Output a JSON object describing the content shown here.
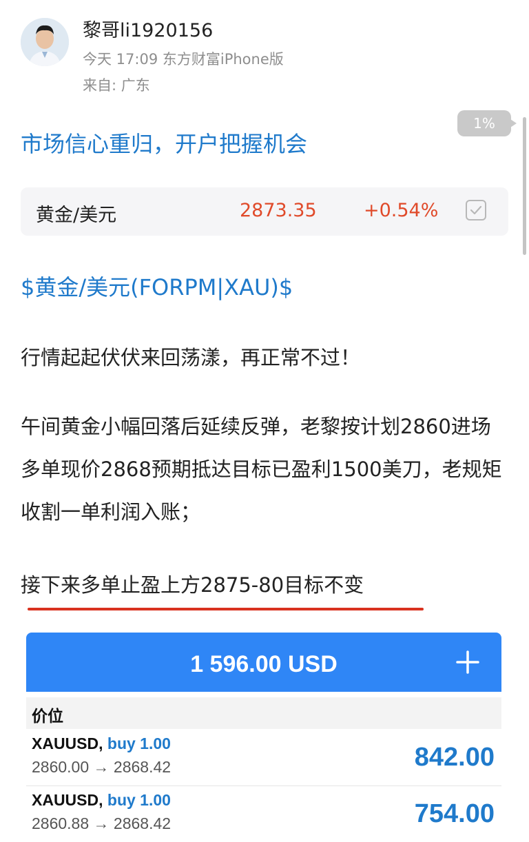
{
  "post": {
    "username": "黎哥li1920156",
    "time_source": "今天 17:09 东方财富iPhone版",
    "from": "来自: 广东",
    "progress": "1%",
    "title": "市场信心重归，开户把握机会"
  },
  "quote": {
    "name": "黄金/美元",
    "price": "2873.35",
    "change": "+0.54%"
  },
  "body": {
    "tag_link": "$黄金/美元(FORPM|XAU)$",
    "p1": "行情起起伏伏来回荡漾，再正常不过！",
    "p2": "午间黄金小幅回落后延续反弹，老黎按计划2860进场多单现价2868预期抵达目标已盈利1500美刀，老规矩收割一单利润入账；",
    "p3": "接下来多单止盈上方2875-80目标不变"
  },
  "trade_panel": {
    "balance": "1 596.00 USD",
    "column_header": "价位",
    "accent_color": "#2f86f6",
    "positions": [
      {
        "symbol": "XAUUSD,",
        "side": "buy 1.00",
        "path": "2860.00 → 2868.42",
        "profit": "842.00"
      },
      {
        "symbol": "XAUUSD,",
        "side": "buy 1.00",
        "path": "2860.88 → 2868.42",
        "profit": "754.00"
      }
    ]
  }
}
